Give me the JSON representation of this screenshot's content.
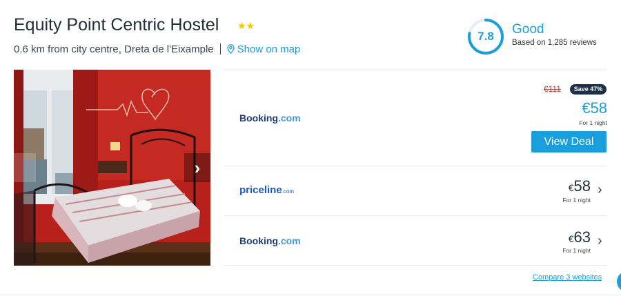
{
  "hotel": {
    "name": "Equity Point Centric Hostel",
    "stars": "★★",
    "distance": "0.6 km from city centre, Dreta de l'Eixample",
    "map_link": "Show on map"
  },
  "rating": {
    "score": "7.8",
    "score_fraction": 0.78,
    "label": "Good",
    "reviews": "Based on 1,285 reviews",
    "color": "#1a9fdd"
  },
  "photo": {
    "next_icon": "›",
    "prev_icon": "chevron-left-icon"
  },
  "deals": {
    "top": {
      "provider": "Booking",
      "provider_suffix": ".com",
      "old_price": "€111",
      "discount": "Save 47%",
      "price": "€58",
      "per_night": "For 1 night",
      "cta": "View Deal"
    },
    "second": {
      "provider": "priceline",
      "provider_suffix": ".com",
      "currency": "€",
      "price": "58",
      "per_night": "For 1 night",
      "chevron": "›"
    },
    "third": {
      "provider": "Booking",
      "provider_suffix": ".com",
      "currency": "€",
      "price": "63",
      "per_night": "For 1 night",
      "chevron": "›"
    },
    "compare_link": "Compare 3 websites"
  },
  "colors": {
    "accent": "#1a9fdd",
    "strike_red": "#e0302a",
    "badge_dark": "#1f2f45",
    "star_yellow": "#f5c400"
  }
}
